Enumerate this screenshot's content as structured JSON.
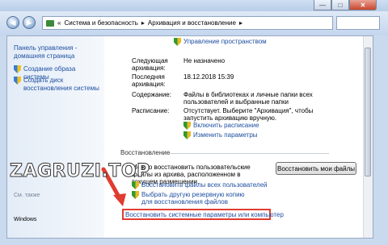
{
  "titlebar": {
    "minimize": "—",
    "maximize": "□",
    "close": "✕"
  },
  "nav": {
    "back": "◀",
    "forward": "▶",
    "breadcrumb": [
      "«",
      "Система и безопасность",
      "▸",
      "Архивация и восстановление",
      "▸"
    ]
  },
  "sidebar": {
    "home": "Панель управления - домашняя страница",
    "items": [
      {
        "label": "Создание образа системы",
        "icon": "shield-icon"
      },
      {
        "label": "Создать диск восстановления системы",
        "icon": "shield-icon"
      }
    ],
    "see_also": "См. также",
    "bottom_item": "Windows"
  },
  "archive": {
    "manage_space": "Управление пространством",
    "next_label": "Следующая архивация:",
    "next_value": "Не назначено",
    "last_label": "Последняя архивация:",
    "last_value": "18.12.2018 15:39",
    "contents_label": "Содержание:",
    "contents_value": "Файлы в библиотеках и личные папки всех пользователей и выбранные папки",
    "schedule_label": "Расписание:",
    "schedule_value": "Отсутствует. Выберите \"Архивация\", чтобы запустить архивацию вручную.",
    "enable_schedule": "Включить расписание",
    "change_params": "Изменить параметры"
  },
  "restore": {
    "title": "Восстановление",
    "description": "Можно восстановить пользовательские файлы из архива, расположенном в текущем размещении.",
    "button": "Восстановить мои файлы",
    "restore_all_users": "Восстановить файлы всех пользователей",
    "choose_other": "Выбрать другую резервную копию для восстановления файлов",
    "restore_system": "Восстановить системные параметры или компьютер"
  },
  "watermark": "ZAGRUZI.TOP",
  "colors": {
    "link": "#1e4fa1",
    "highlight": "#e03c2f",
    "window_bg": "#c9d9ee"
  }
}
